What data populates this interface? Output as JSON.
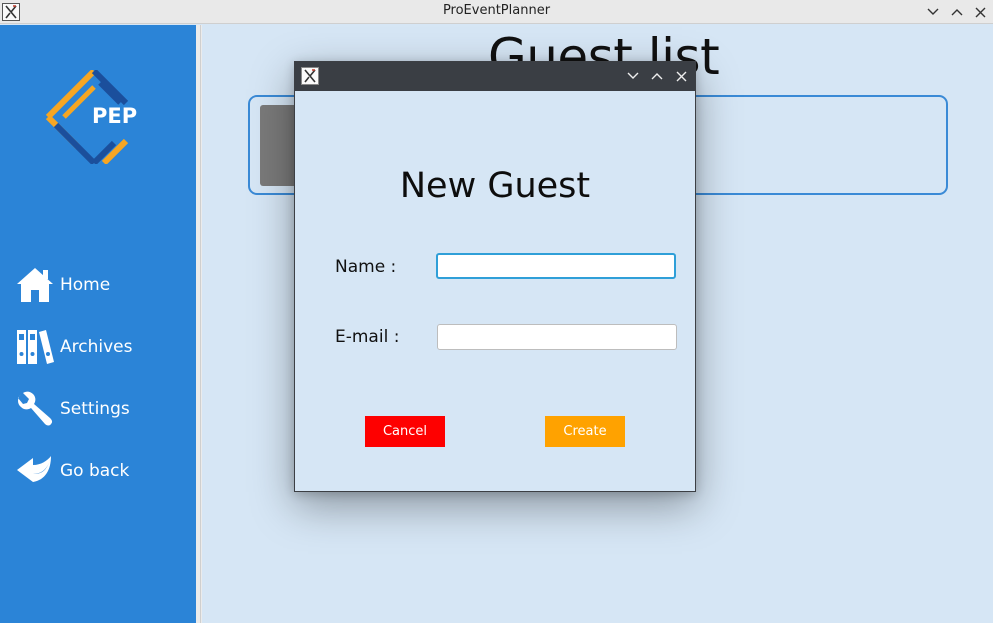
{
  "window": {
    "title": "ProEventPlanner"
  },
  "sidebar": {
    "logo_text": "PEP",
    "items": [
      {
        "label": "Home",
        "icon": "home-icon"
      },
      {
        "label": "Archives",
        "icon": "archive-binders-icon"
      },
      {
        "label": "Settings",
        "icon": "wrench-icon"
      },
      {
        "label": "Go back",
        "icon": "back-arrow-icon"
      }
    ]
  },
  "main": {
    "title": "Guest list"
  },
  "dialog": {
    "heading": "New Guest",
    "name_label": "Name :",
    "name_value": "",
    "email_label": "E-mail :",
    "email_value": "",
    "cancel_label": "Cancel",
    "create_label": "Create"
  },
  "colors": {
    "sidebar": "#2b84d7",
    "background": "#d6e6f5",
    "cancel": "#fe0000",
    "create": "#ffa200",
    "logo_orange": "#f6a623",
    "logo_navy": "#1b4f9c"
  }
}
